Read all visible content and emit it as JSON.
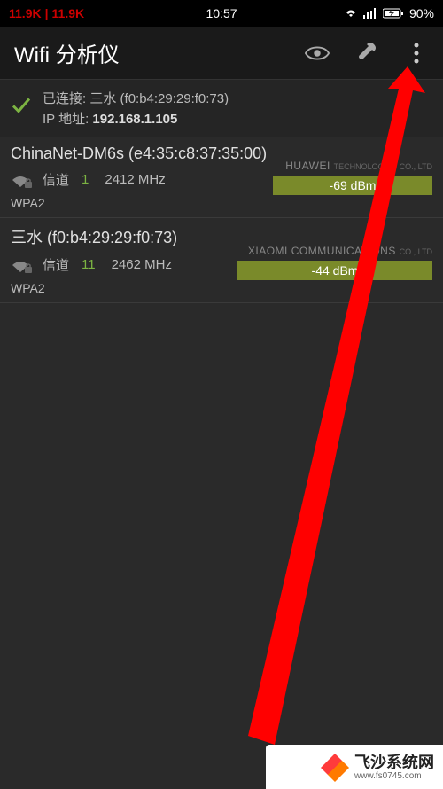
{
  "status_bar": {
    "net_down": "11.9K",
    "net_sep": "|",
    "net_up": "11.9K",
    "time": "10:57",
    "battery": "90%"
  },
  "app_bar": {
    "title": "Wifi 分析仪"
  },
  "connected": {
    "label": "已连接:",
    "ssid": "三水",
    "mac": "(f0:b4:29:29:f0:73)",
    "ip_label": "IP 地址:",
    "ip": "192.168.1.105"
  },
  "networks": [
    {
      "ssid": "ChinaNet-DM6s",
      "mac": "(e4:35:c8:37:35:00)",
      "channel_label": "信道",
      "channel": "1",
      "freq": "2412 MHz",
      "vendor": "HUAWEI",
      "vendor_suffix": "TECHNOLOGIES CO., LTD",
      "signal": "-69 dBm",
      "signal_width": 180,
      "security": "WPA2"
    },
    {
      "ssid": "三水",
      "mac": "(f0:b4:29:29:f0:73)",
      "channel_label": "信道",
      "channel": "11",
      "freq": "2462 MHz",
      "vendor": "XIAOMI COMMUNICATIONS",
      "vendor_suffix": "CO., LTD",
      "signal": "-44 dBm",
      "signal_width": 220,
      "security": "WPA2"
    }
  ],
  "watermark": {
    "main": "飞沙系统网",
    "sub": "www.fs0745.com"
  }
}
